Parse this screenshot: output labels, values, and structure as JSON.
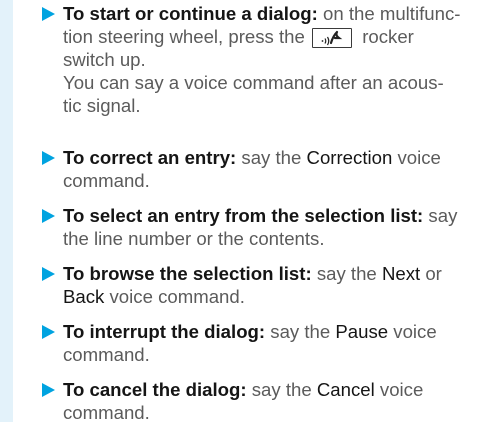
{
  "items": [
    {
      "bold": "To start or continue a dialog:",
      "line1_rest": " on the multifunc-",
      "line2_pre": "tion steering wheel, press the",
      "line2_post": " rocker",
      "line3": "switch up.",
      "line4": "You can say a voice command after an acous-",
      "line5": "tic signal.",
      "key_icon": "voice-control-icon"
    },
    {
      "bold": "To correct an entry:",
      "pre": " say the ",
      "keyword": "Correction",
      "post": " voice",
      "line2": "command."
    },
    {
      "bold": "To select an entry from the selection list:",
      "post": " say",
      "line2": "the line number or the contents."
    },
    {
      "bold": "To browse the selection list:",
      "pre": " say the ",
      "keyword": "Next",
      "post": " or",
      "keyword2": "Back",
      "line2_post": " voice command."
    },
    {
      "bold": "To interrupt the dialog:",
      "pre": " say the ",
      "keyword": "Pause",
      "post": " voice",
      "line2": "command."
    },
    {
      "bold": "To cancel the dialog:",
      "pre": " say the ",
      "keyword": "Cancel",
      "post": " voice",
      "line2": "command."
    }
  ]
}
